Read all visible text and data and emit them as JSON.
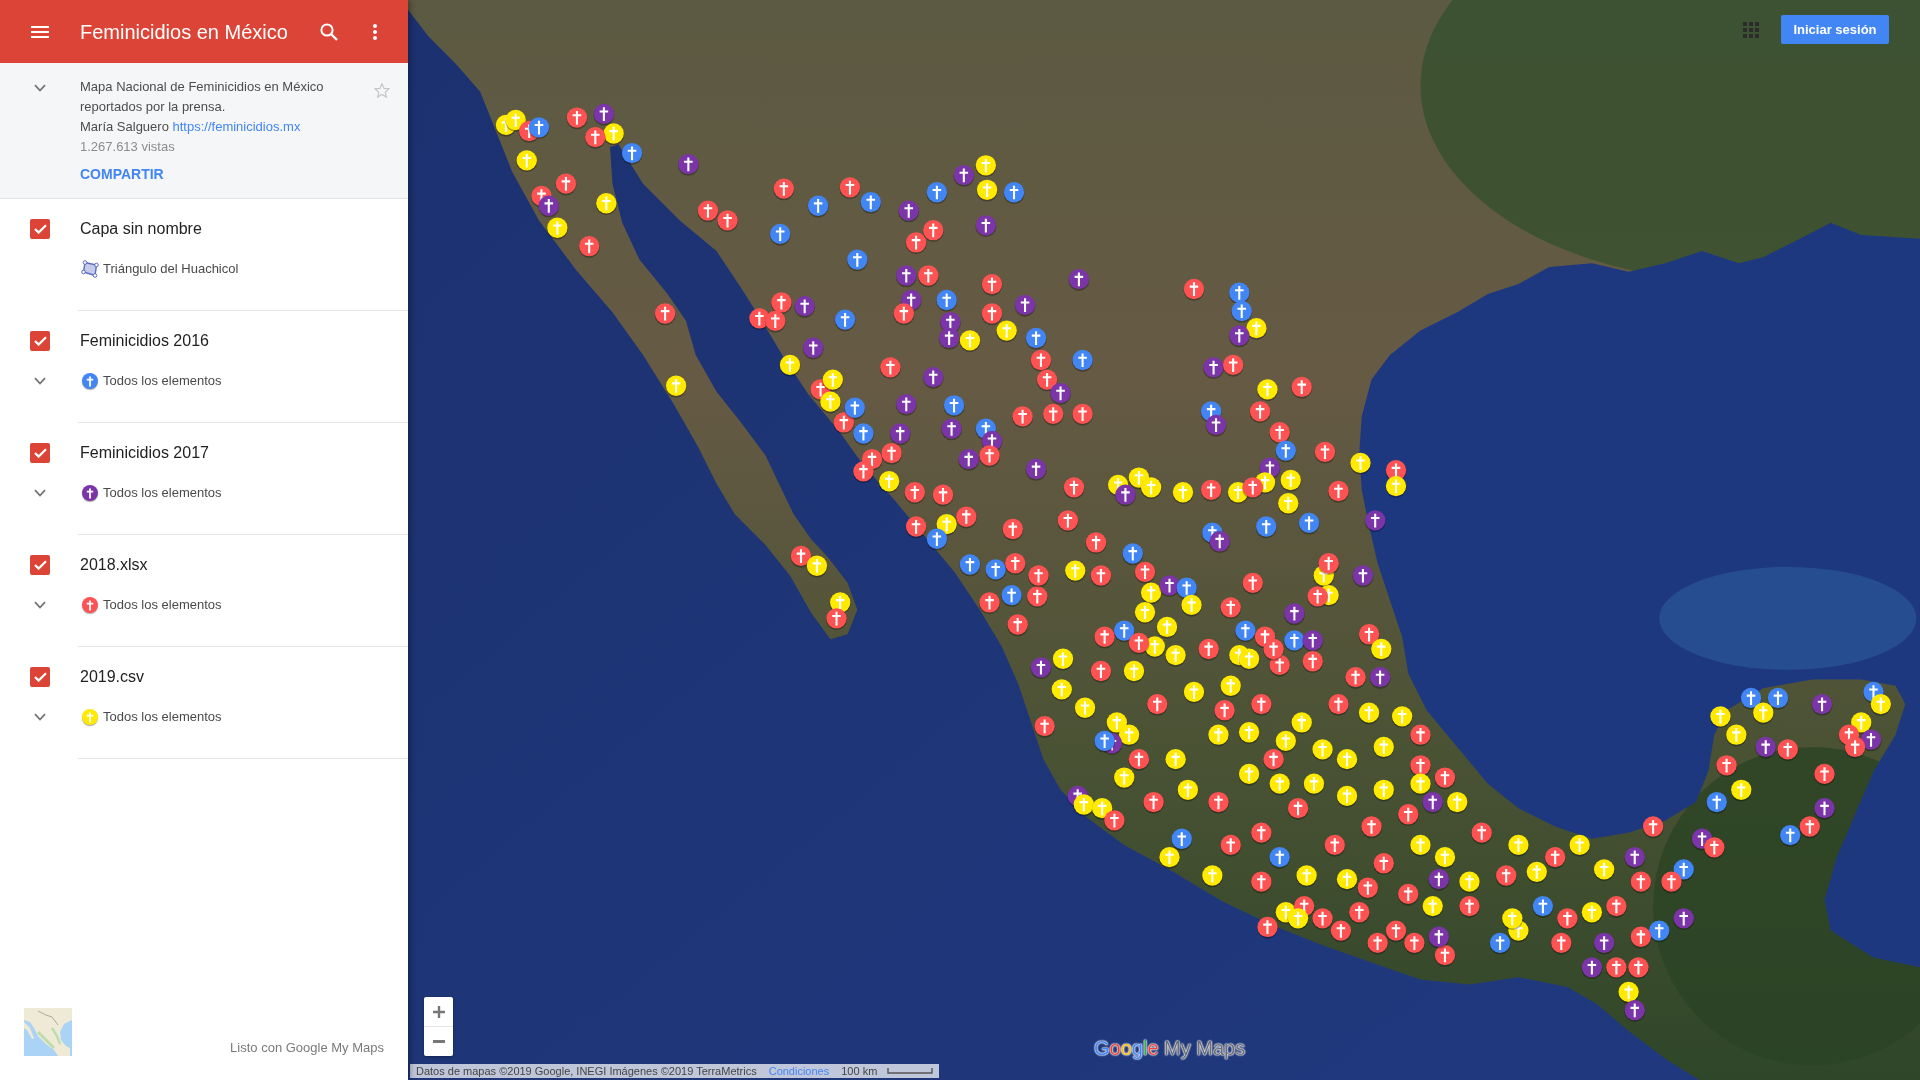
{
  "app_bar": {
    "title": "Feminicidios en México"
  },
  "map_info": {
    "description": "Mapa Nacional de Feminicidios en México reportados por la prensa.",
    "author": "María Salguero",
    "link": "https://feminicidios.mx",
    "views": "1.267.613 vistas",
    "share": "COMPARTIR",
    "starred": false
  },
  "layers": [
    {
      "name": "Capa sin nombre",
      "checked": true,
      "item": {
        "kind": "shape",
        "label": "Triángulo del Huachicol"
      }
    },
    {
      "name": "Feminicidios 2016",
      "checked": true,
      "color": "#4285f4",
      "item": {
        "kind": "style_group",
        "label": "Todos los elementos"
      }
    },
    {
      "name": "Feminicidios 2017",
      "checked": true,
      "color": "#7b35a8",
      "item": {
        "kind": "style_group",
        "label": "Todos los elementos"
      }
    },
    {
      "name": "2018.xlsx",
      "checked": true,
      "color": "#ff5252",
      "item": {
        "kind": "style_group",
        "label": "Todos los elementos"
      }
    },
    {
      "name": "2019.csv",
      "checked": true,
      "color": "#ffea00",
      "item": {
        "kind": "style_group",
        "label": "Todos los elementos"
      }
    }
  ],
  "footer": {
    "credit": "Listo con Google My Maps"
  },
  "map": {
    "sign_in": "Iniciar sesión",
    "attribution": "Datos de mapas ©2019 Google, INEGI Imágenes ©2019 TerraMetrics",
    "terms": "Condiciones",
    "scale": "100 km",
    "logo": {
      "brand": "Google",
      "product": "My Maps"
    }
  }
}
